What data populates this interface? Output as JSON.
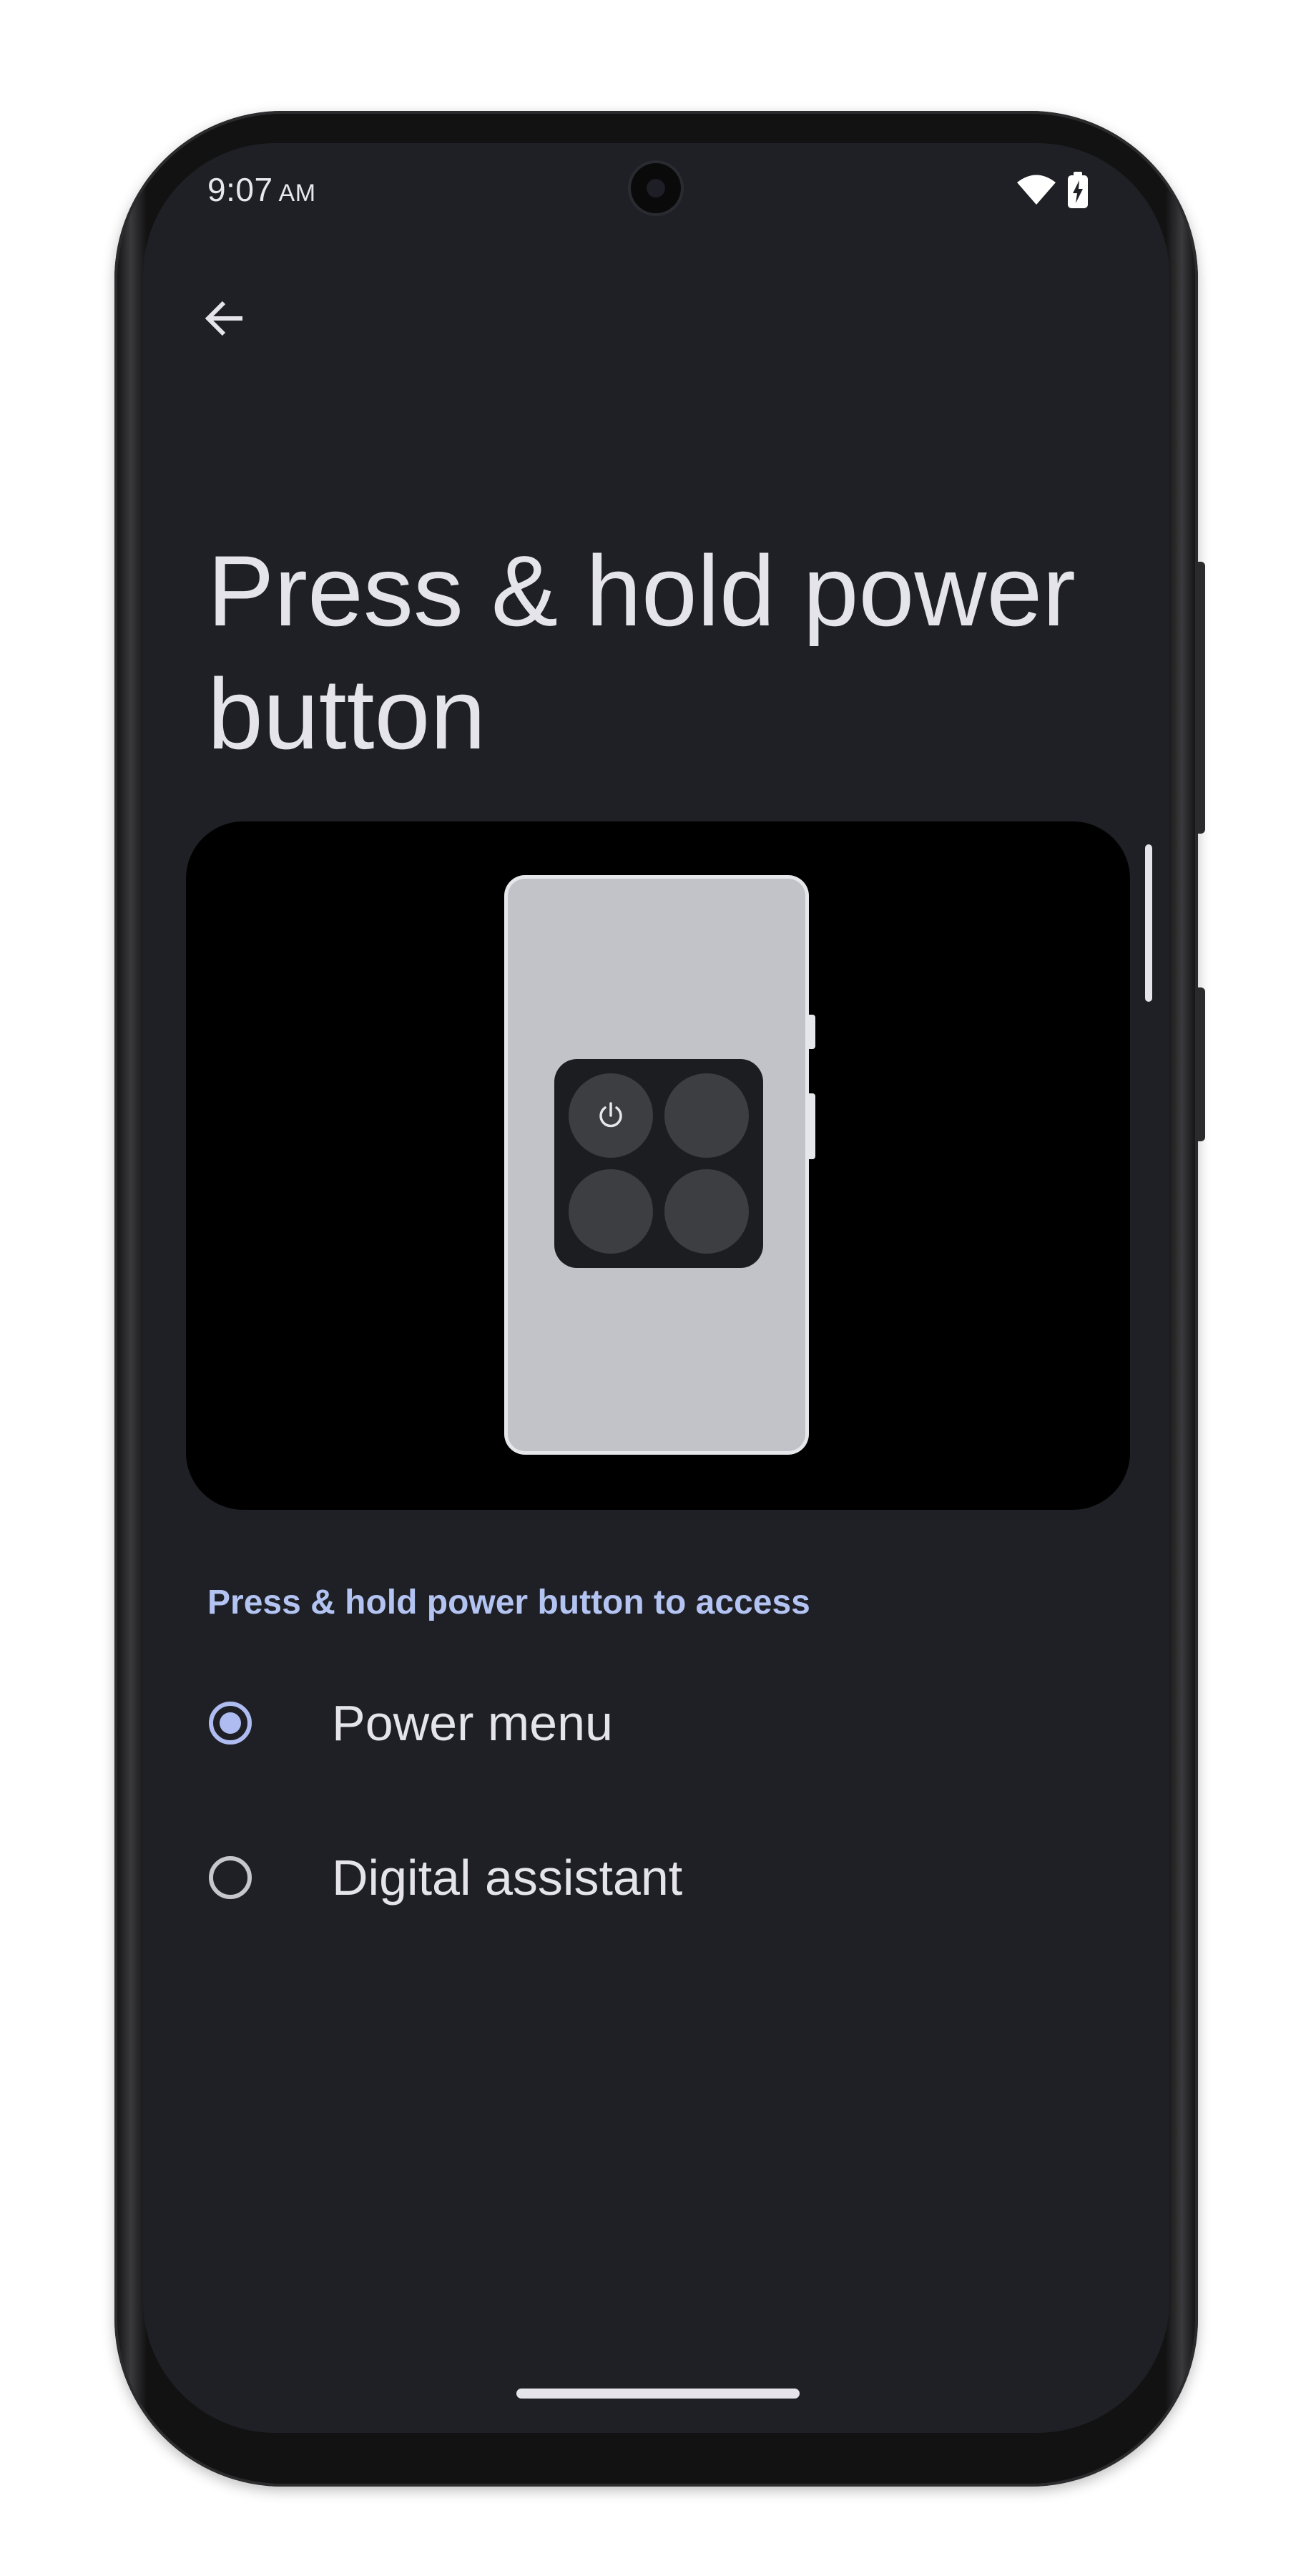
{
  "status_bar": {
    "time": "9:07",
    "ampm": "AM",
    "icons": [
      "wifi-icon",
      "battery-charging-icon"
    ]
  },
  "navigation": {
    "back_icon": "arrow-left-icon"
  },
  "page": {
    "title": "Press & hold power button"
  },
  "illustration": {
    "icon": "power-icon"
  },
  "settings": {
    "section_header": "Press & hold power button to access",
    "options": [
      {
        "label": "Power menu",
        "selected": true
      },
      {
        "label": "Digital assistant",
        "selected": false
      }
    ]
  },
  "colors": {
    "background": "#1f2025",
    "accent": "#aebcf1",
    "section_header": "#b3c3f2",
    "text": "#e4e4ea"
  }
}
